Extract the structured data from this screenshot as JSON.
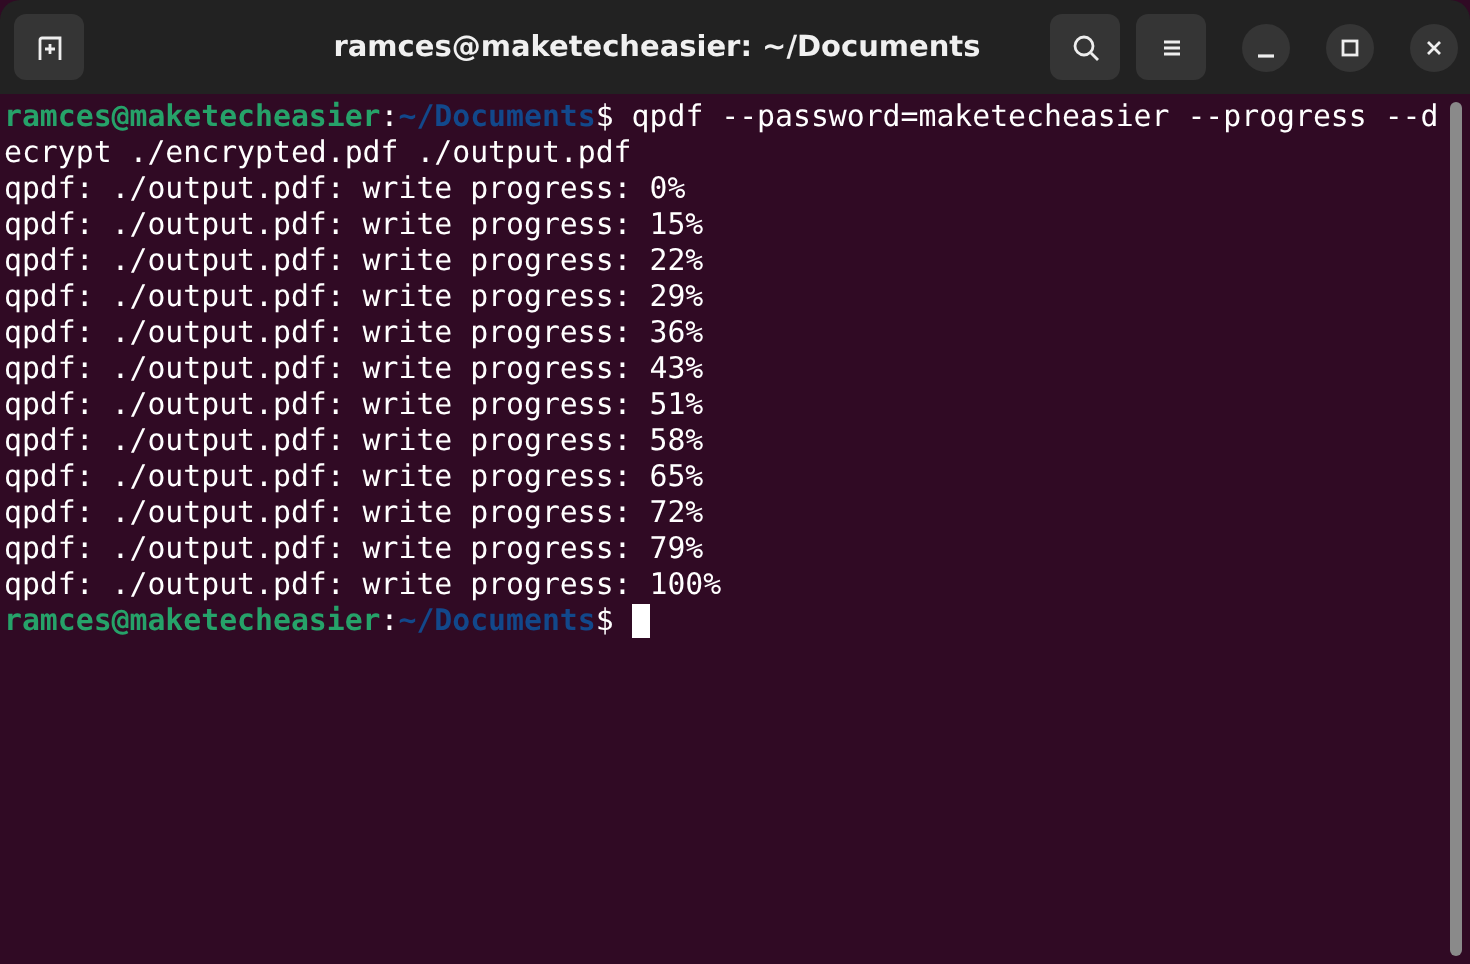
{
  "window": {
    "title": "ramces@maketecheasier: ~/Documents"
  },
  "terminal": {
    "lines": [
      {
        "kind": "prompt",
        "user": "ramces@maketecheasier",
        "separator": ":",
        "path": "~/Documents",
        "symbol": "$",
        "command": "qpdf --password=maketecheasier --progress --d",
        "cursor": false
      },
      {
        "kind": "output",
        "text": "ecrypt ./encrypted.pdf ./output.pdf"
      },
      {
        "kind": "output",
        "text": "qpdf: ./output.pdf: write progress: 0%"
      },
      {
        "kind": "output",
        "text": "qpdf: ./output.pdf: write progress: 15%"
      },
      {
        "kind": "output",
        "text": "qpdf: ./output.pdf: write progress: 22%"
      },
      {
        "kind": "output",
        "text": "qpdf: ./output.pdf: write progress: 29%"
      },
      {
        "kind": "output",
        "text": "qpdf: ./output.pdf: write progress: 36%"
      },
      {
        "kind": "output",
        "text": "qpdf: ./output.pdf: write progress: 43%"
      },
      {
        "kind": "output",
        "text": "qpdf: ./output.pdf: write progress: 51%"
      },
      {
        "kind": "output",
        "text": "qpdf: ./output.pdf: write progress: 58%"
      },
      {
        "kind": "output",
        "text": "qpdf: ./output.pdf: write progress: 65%"
      },
      {
        "kind": "output",
        "text": "qpdf: ./output.pdf: write progress: 72%"
      },
      {
        "kind": "output",
        "text": "qpdf: ./output.pdf: write progress: 79%"
      },
      {
        "kind": "output",
        "text": "qpdf: ./output.pdf: write progress: 100%"
      },
      {
        "kind": "prompt",
        "user": "ramces@maketecheasier",
        "separator": ":",
        "path": "~/Documents",
        "symbol": "$",
        "cursor": true
      }
    ]
  }
}
